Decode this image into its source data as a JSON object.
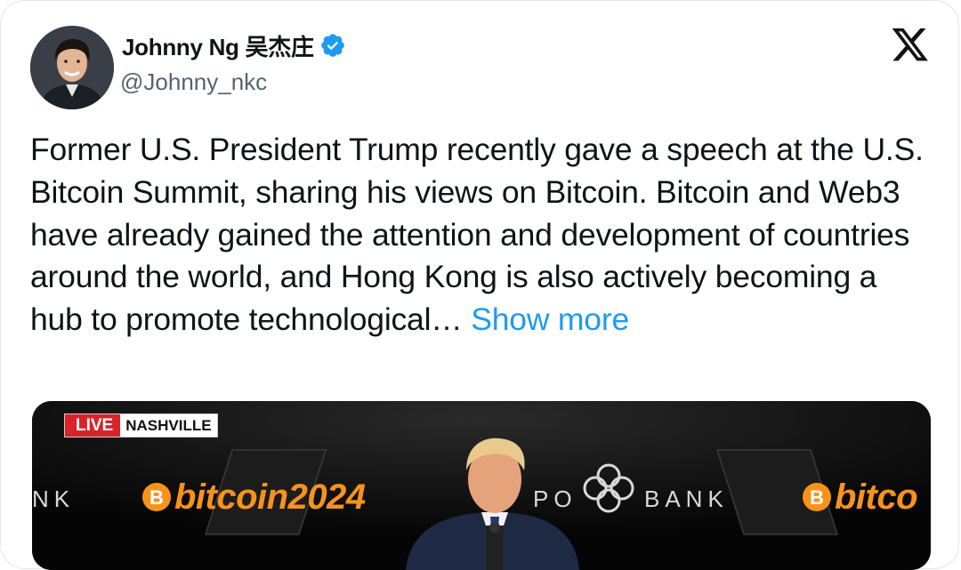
{
  "author": {
    "display_name": "Johnny Ng 吴杰庄",
    "handle": "@Johnny_nkc",
    "verified": true
  },
  "platform_logo": "x-logo-icon",
  "tweet": {
    "text": "Former U.S. President Trump recently gave a speech at the U.S. Bitcoin Summit, sharing his views on Bitcoin. Bitcoin and Web3 have already gained the attention and development of countries around the world, and Hong Kong is also actively becoming a hub to promote technological…",
    "show_more_label": "Show more"
  },
  "media": {
    "live_label": "LIVE",
    "location_label": "NASHVILLE",
    "banner_left": "NK",
    "btc_word": "bitcoin",
    "btc_year": "2024",
    "sponsor_left": "PO",
    "sponsor_right": "BANK",
    "btc_word_right": "bitco"
  },
  "colors": {
    "link": "#1d9bf0",
    "verified": "#1d9bf0",
    "live_red": "#d8232a",
    "bitcoin_orange": "#f7931a",
    "text": "#0f1419",
    "muted": "#536471"
  }
}
